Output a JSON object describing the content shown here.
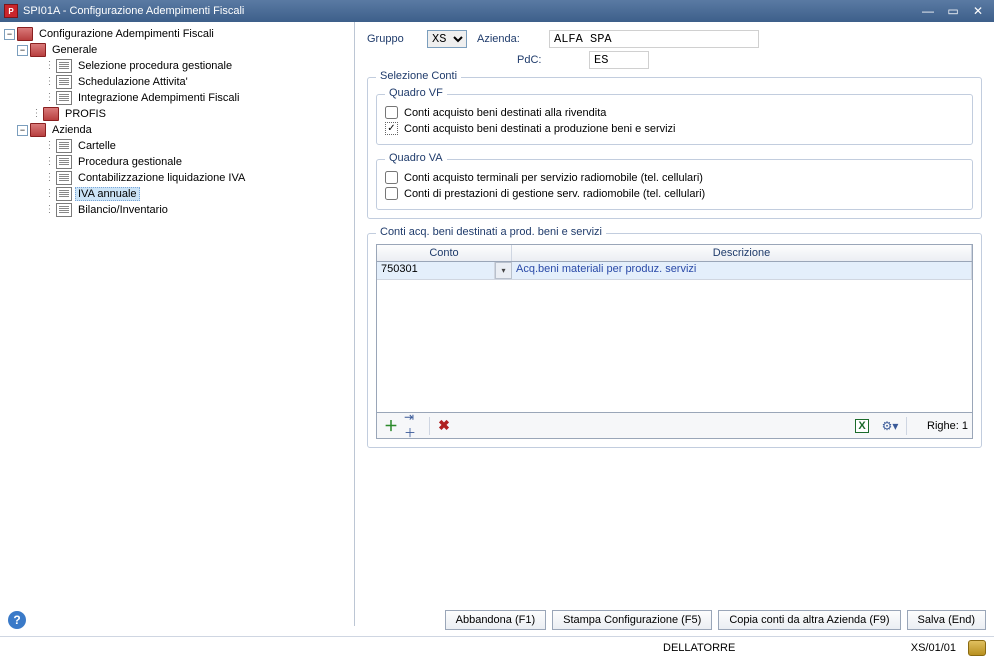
{
  "window": {
    "title": "SPI01A - Configurazione Adempimenti Fiscali"
  },
  "tree": {
    "root": "Configurazione Adempimenti Fiscali",
    "generale": {
      "label": "Generale",
      "items": [
        "Selezione procedura gestionale",
        "Schedulazione Attivita'",
        "Integrazione Adempimenti Fiscali"
      ]
    },
    "profis": "PROFIS",
    "azienda": {
      "label": "Azienda",
      "items": [
        "Cartelle",
        "Procedura gestionale",
        "Contabilizzazione liquidazione IVA",
        "IVA annuale",
        "Bilancio/Inventario"
      ]
    },
    "selected": "IVA annuale"
  },
  "header": {
    "gruppo_label": "Gruppo",
    "gruppo_value": "XS",
    "azienda_label": "Azienda:",
    "azienda_value": "ALFA SPA",
    "pdc_label": "PdC:",
    "pdc_value": "ES"
  },
  "selezione_conti": {
    "legend": "Selezione Conti",
    "quadro_vf": {
      "legend": "Quadro VF",
      "opt1": {
        "label": "Conti acquisto beni destinati alla rivendita",
        "checked": false
      },
      "opt2": {
        "label": "Conti acquisto beni destinati a produzione beni e servizi",
        "checked": true
      }
    },
    "quadro_va": {
      "legend": "Quadro VA",
      "opt1": {
        "label": "Conti acquisto terminali per servizio radiomobile (tel. cellulari)",
        "checked": false
      },
      "opt2": {
        "label": "Conti di prestazioni di gestione serv. radiomobile (tel. cellulari)",
        "checked": false
      }
    }
  },
  "table": {
    "legend": "Conti acq. beni destinati a prod. beni e servizi",
    "columns": {
      "conto": "Conto",
      "descrizione": "Descrizione"
    },
    "rows": [
      {
        "conto": "750301",
        "descrizione": "Acq.beni materiali per produz. servizi"
      }
    ],
    "footer": {
      "righe_label": "Righe:",
      "righe_count": "1"
    }
  },
  "buttons": {
    "abbandona": "Abbandona (F1)",
    "stampa": "Stampa Configurazione (F5)",
    "copia": "Copia conti da altra Azienda (F9)",
    "salva": "Salva (End)"
  },
  "statusbar": {
    "user": "DELLATORRE",
    "code": "XS/01/01"
  }
}
